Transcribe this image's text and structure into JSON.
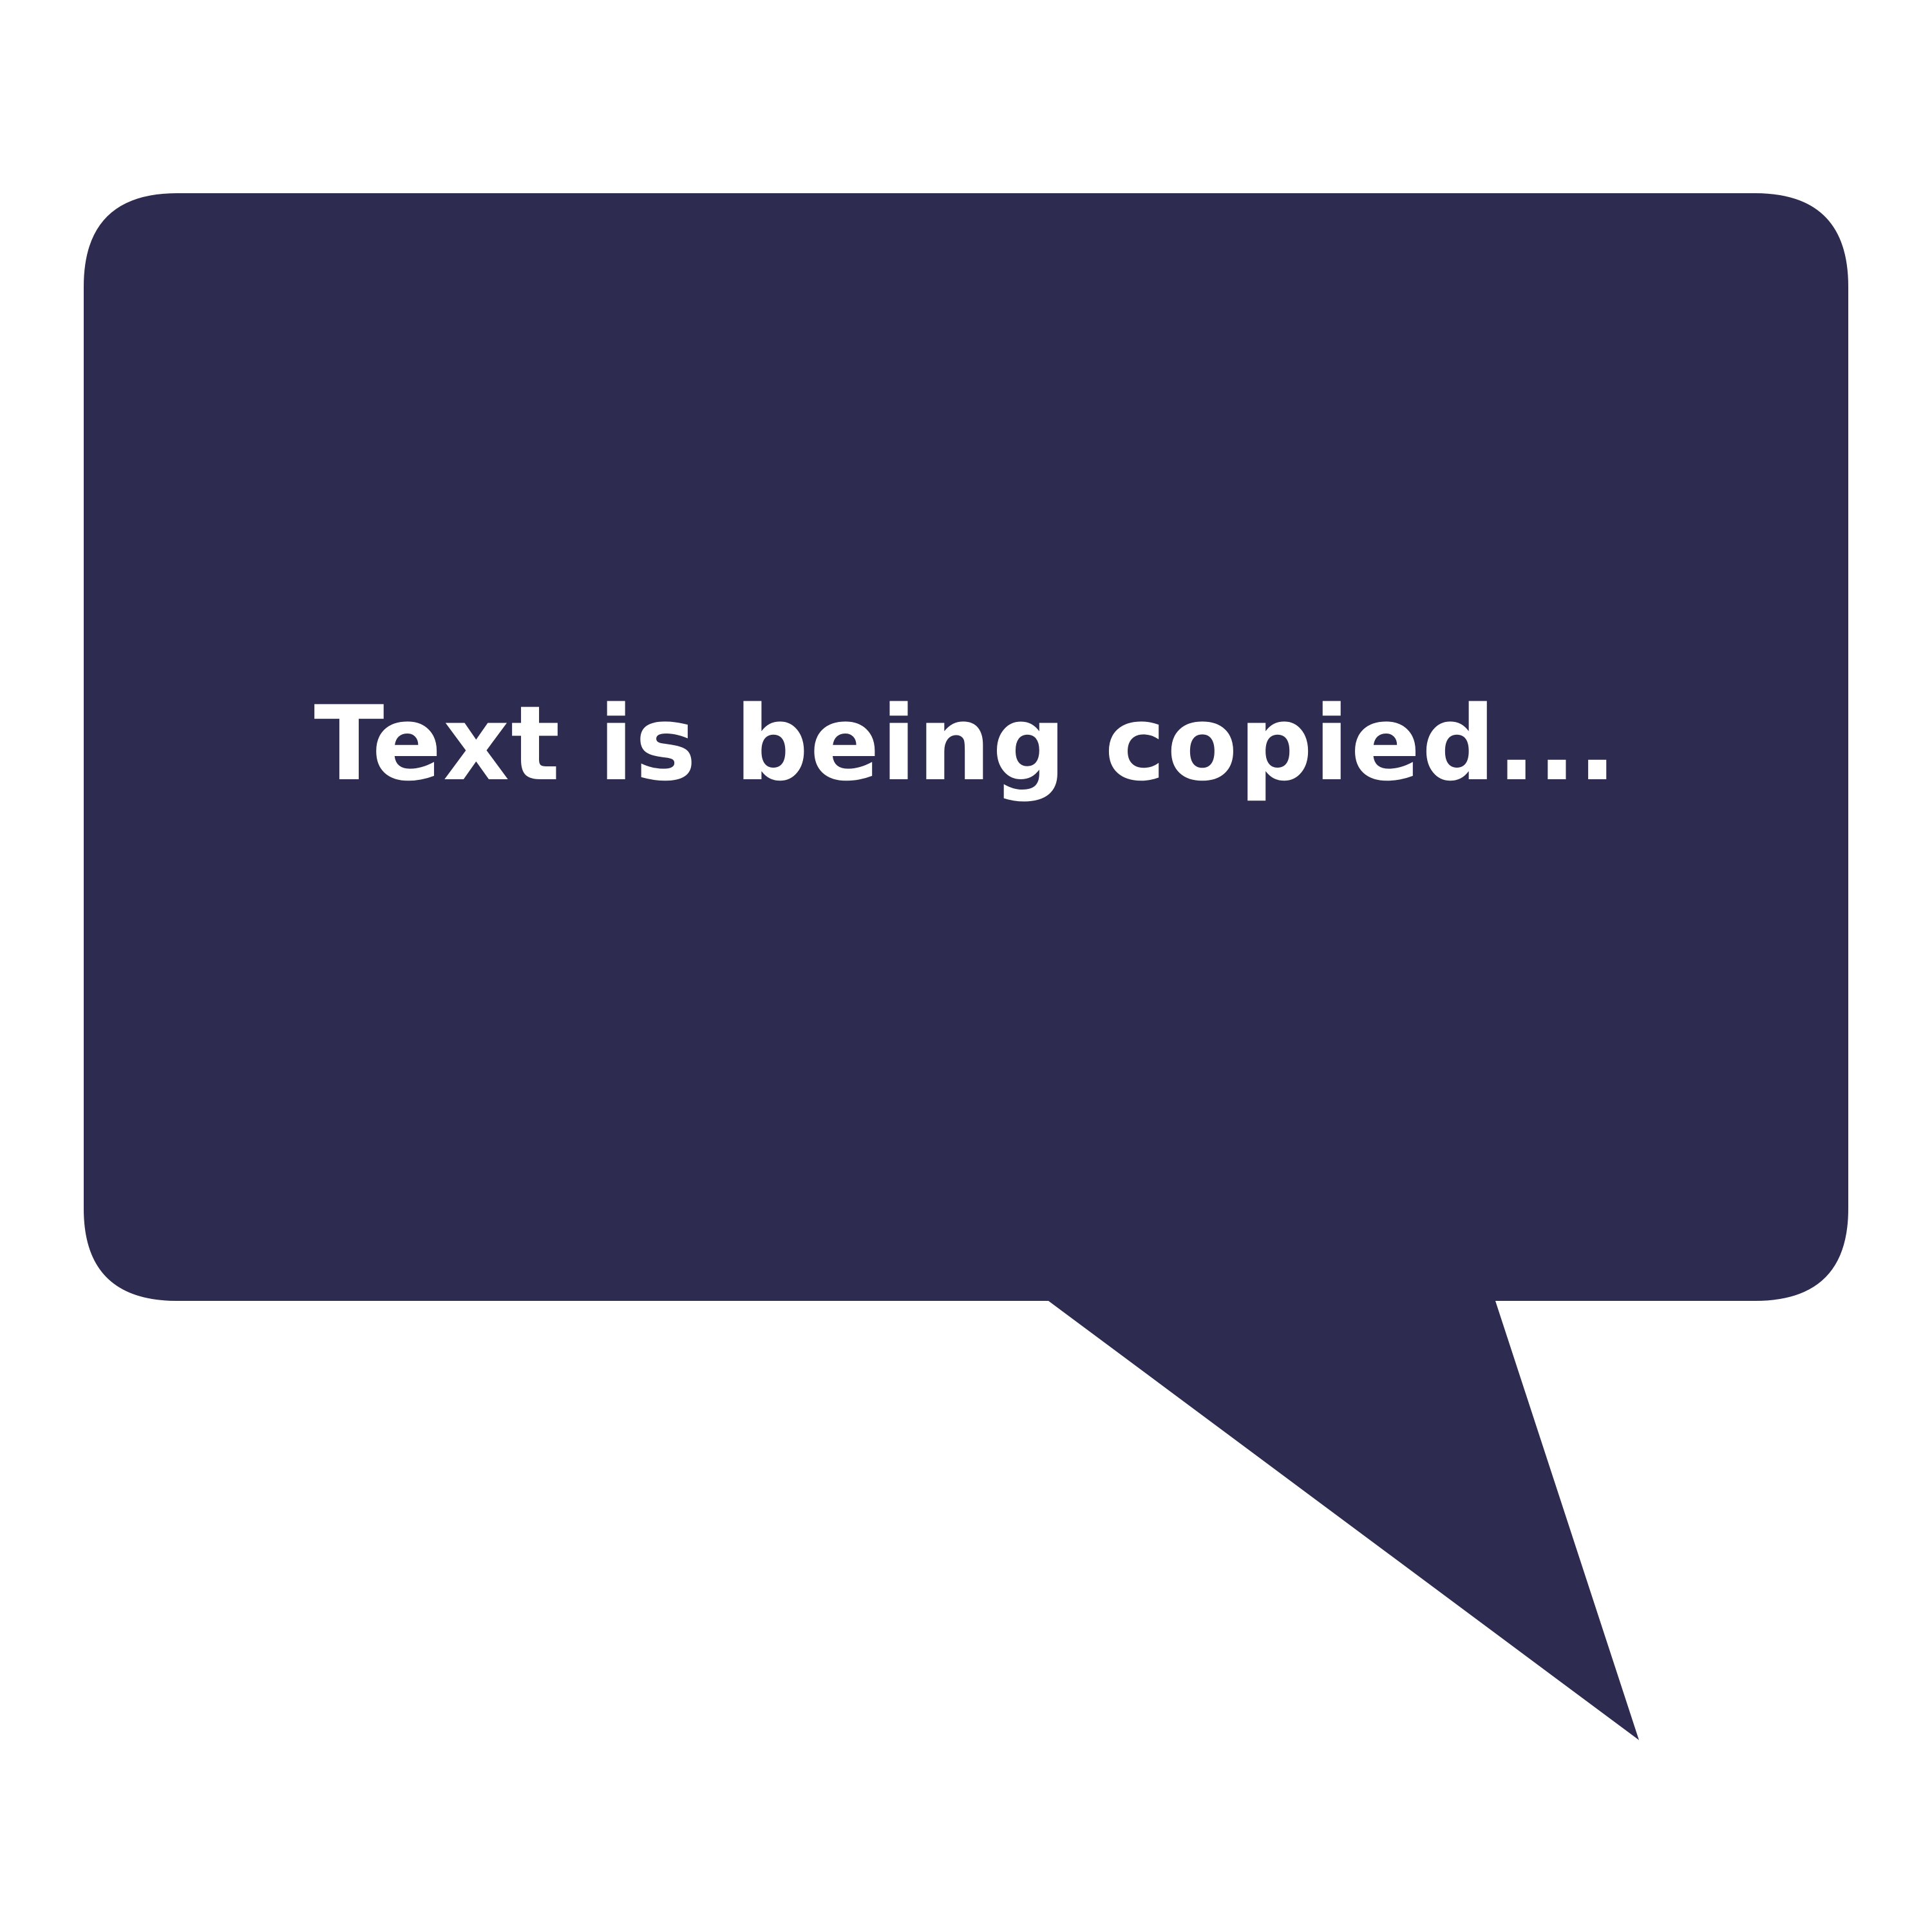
{
  "colors": {
    "background": "#ffffff",
    "bubble": "#2d2b4f",
    "text": "#ffffff"
  },
  "bubble": {
    "message": "Text is being copied..."
  }
}
